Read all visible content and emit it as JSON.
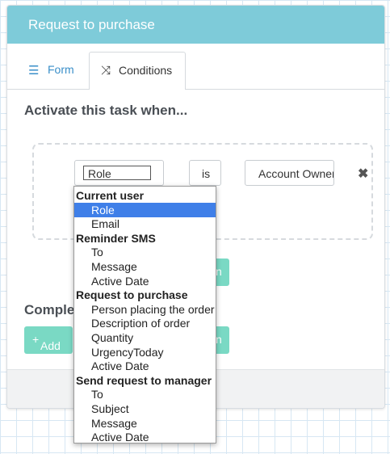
{
  "header": {
    "title": "Request to purchase"
  },
  "tabs": {
    "form": "Form",
    "conditions": "Conditions",
    "form_icon": "form-icon",
    "conditions_icon": "shuffle-icon"
  },
  "section_title": "Activate this task when...",
  "condition": {
    "field": "Role",
    "operator": "is",
    "value": "Account Owner"
  },
  "complete_label": "Comple",
  "add_button": "Add",
  "dropdown": {
    "groups": [
      {
        "label": "Current user",
        "items": [
          "Role",
          "Email"
        ]
      },
      {
        "label": "Reminder SMS",
        "items": [
          "To",
          "Message",
          "Active Date"
        ]
      },
      {
        "label": "Request to purchase",
        "items": [
          "Person placing the order",
          "Description of order",
          "Quantity",
          "UrgencyToday",
          "Active Date"
        ]
      },
      {
        "label": "Send request to manager",
        "items": [
          "To",
          "Subject",
          "Message",
          "Active Date"
        ]
      }
    ],
    "selected": "Role"
  },
  "colors": {
    "header": "#7ecbd9",
    "accent_green": "#7ad9c4",
    "selected": "#3f7fe8"
  }
}
